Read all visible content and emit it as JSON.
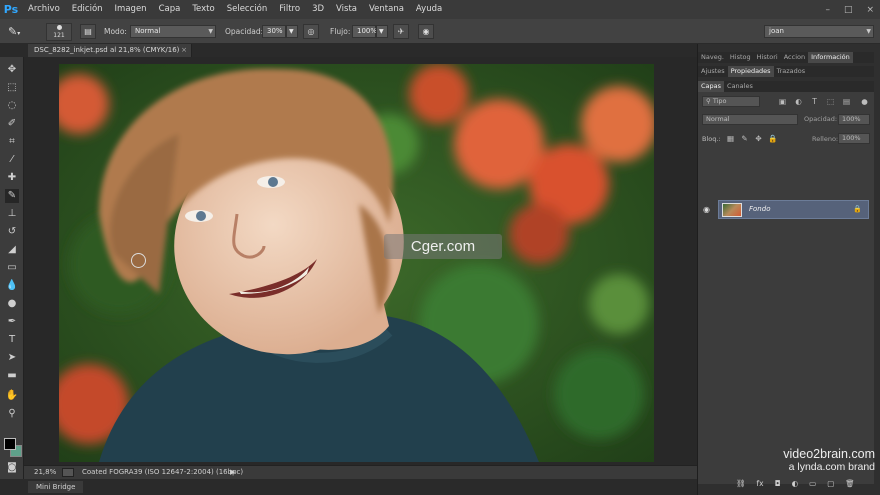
{
  "app": {
    "logo": "Ps"
  },
  "menu": [
    "Archivo",
    "Edición",
    "Imagen",
    "Capa",
    "Texto",
    "Selección",
    "Filtro",
    "3D",
    "Vista",
    "Ventana",
    "Ayuda"
  ],
  "window_controls": [
    "–",
    "□",
    "×"
  ],
  "options": {
    "brush_size": "121",
    "mode_label": "Modo:",
    "mode_value": "Normal",
    "opacity_label": "Opacidad:",
    "opacity_value": "30%",
    "flow_label": "Flujo:",
    "flow_value": "100%",
    "workspace_value": "joan"
  },
  "document": {
    "tab_label": "DSC_8282_inkjet.psd al 21,8% (CMYK/16)",
    "tab_close": "×",
    "zoom": "21,8%",
    "profile": "Coated FOGRA39 (ISO 12647-2:2004) (16bpc)",
    "status_arrow": "▶"
  },
  "panels": {
    "top_tabs": [
      {
        "label": "Naveg.",
        "active": false
      },
      {
        "label": "Histog",
        "active": false
      },
      {
        "label": "Histori",
        "active": false
      },
      {
        "label": "Accion",
        "active": false
      },
      {
        "label": "Información",
        "active": true
      }
    ],
    "mid_tabs": [
      {
        "label": "Ajustes",
        "active": false
      },
      {
        "label": "Propiedades",
        "active": true
      },
      {
        "label": "Trazados",
        "active": false
      }
    ],
    "layer_tabs": [
      {
        "label": "Capas",
        "active": true
      },
      {
        "label": "Canales",
        "active": false
      }
    ],
    "layers": {
      "filter_placeholder": "Tipo",
      "blend_mode": "Normal",
      "opacity_label": "Opacidad:",
      "opacity_value": "100%",
      "lock_label": "Bloq.:",
      "fill_label": "Relleno:",
      "fill_value": "100%",
      "layer_name": "Fondo"
    }
  },
  "bottom": {
    "mini_bridge": "Mini Bridge"
  },
  "watermark": "Cger.com",
  "brand": {
    "line1": "video2brain.com",
    "line2": "a lynda.com brand"
  },
  "colors": {
    "foreground": "#000000",
    "background": "#5fa08a",
    "accent": "#31a8ff"
  }
}
